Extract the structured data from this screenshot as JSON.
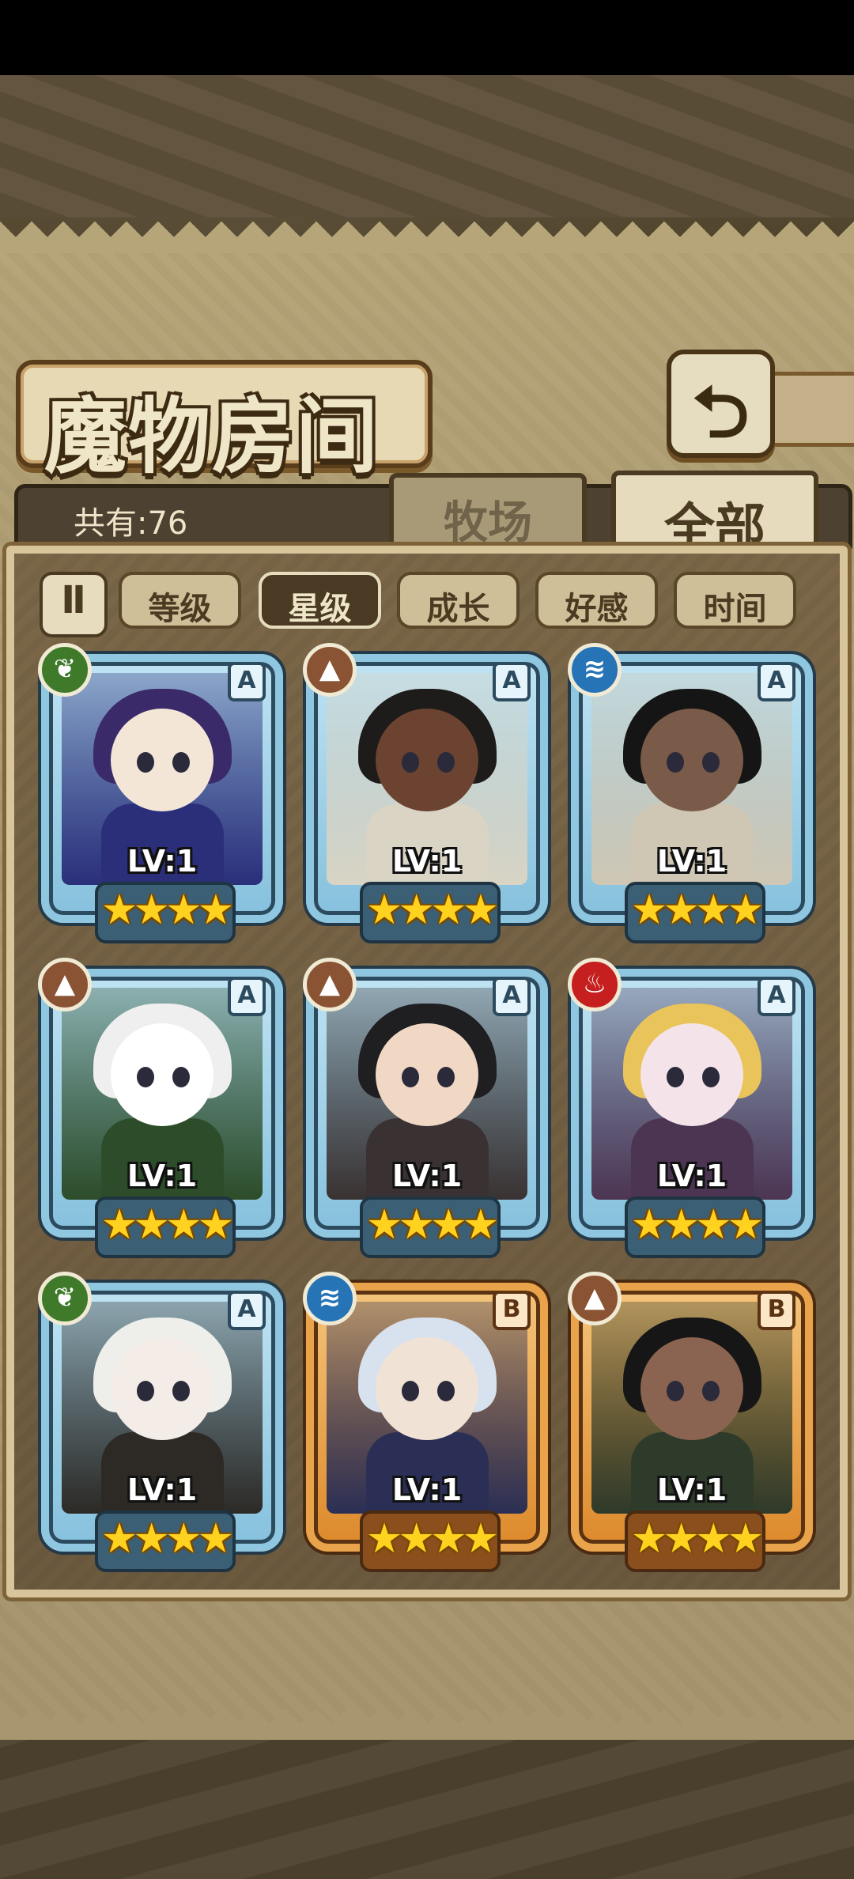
{
  "title": "魔物房间",
  "back_icon": "return-arrow-icon",
  "count_label": "共有:76",
  "tabs": {
    "ranch": "牧场",
    "all": "全部"
  },
  "sort_toggle": "Ⅱ",
  "filters": [
    {
      "label": "等级",
      "active": false
    },
    {
      "label": "星级",
      "active": true
    },
    {
      "label": "成长",
      "active": false
    },
    {
      "label": "好感",
      "active": false
    },
    {
      "label": "时间",
      "active": false
    }
  ],
  "cards": [
    {
      "rank": "A",
      "element": "grass",
      "level": "LV:1",
      "stars": 4,
      "skin": "#f3e6d6",
      "hair": "#3b2a6a",
      "outfit": "#2b2f7a"
    },
    {
      "rank": "A",
      "element": "earth",
      "level": "LV:1",
      "stars": 4,
      "skin": "#6b4330",
      "hair": "#1e1b1b",
      "outfit": "#d9d4c4"
    },
    {
      "rank": "A",
      "element": "water",
      "level": "LV:1",
      "stars": 4,
      "skin": "#7a5a48",
      "hair": "#151515",
      "outfit": "#cfc7b4"
    },
    {
      "rank": "A",
      "element": "earth",
      "level": "LV:1",
      "stars": 4,
      "skin": "#ffffff",
      "hair": "#efefef",
      "outfit": "#2d4d2a"
    },
    {
      "rank": "A",
      "element": "earth",
      "level": "LV:1",
      "stars": 4,
      "skin": "#f1d8c5",
      "hair": "#1f1f22",
      "outfit": "#3a3232"
    },
    {
      "rank": "A",
      "element": "fire",
      "level": "LV:1",
      "stars": 4,
      "skin": "#f4e4ea",
      "hair": "#e9c45a",
      "outfit": "#4c3553"
    },
    {
      "rank": "A",
      "element": "grass",
      "level": "LV:1",
      "stars": 4,
      "skin": "#f4ece6",
      "hair": "#eeeeea",
      "outfit": "#2d2a26"
    },
    {
      "rank": "B",
      "element": "water",
      "level": "LV:1",
      "stars": 4,
      "skin": "#f1e2d6",
      "hair": "#d8e1ee",
      "outfit": "#2b2f55"
    },
    {
      "rank": "B",
      "element": "earth",
      "level": "LV:1",
      "stars": 4,
      "skin": "#8a6450",
      "hair": "#161616",
      "outfit": "#2e3a2a"
    }
  ],
  "element_glyphs": {
    "grass": "❦",
    "earth": "▲",
    "water": "≋",
    "fire": "♨"
  },
  "star_glyph": "★"
}
